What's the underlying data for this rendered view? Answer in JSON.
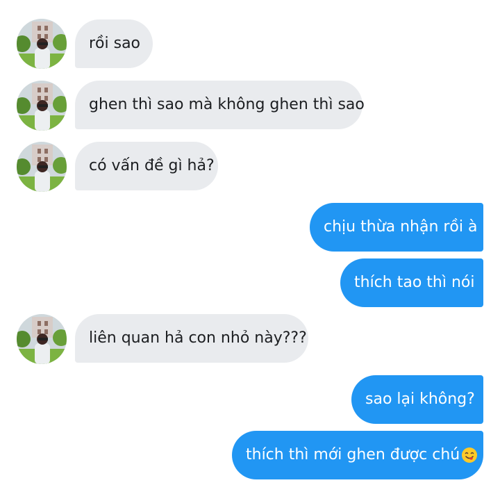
{
  "conversation": {
    "messages": [
      {
        "side": "in",
        "text": "rồi sao"
      },
      {
        "side": "in",
        "text": "ghen thì sao mà không ghen thì sao"
      },
      {
        "side": "in",
        "text": "có vấn đề gì hả?"
      },
      {
        "side": "out",
        "text": "chịu thừa nhận rồi à"
      },
      {
        "side": "out",
        "text": "thích tao thì nói"
      },
      {
        "side": "in",
        "text": "liên quan hả con nhỏ này???"
      },
      {
        "side": "out",
        "text": "sao lại không?"
      },
      {
        "side": "out",
        "text": "thích thì mới ghen được chú",
        "emoji": "smiling-face-savoring-food"
      }
    ]
  },
  "colors": {
    "incoming_bubble": "#e9ebee",
    "outgoing_bubble": "#2196f3",
    "outgoing_text": "#ffffff",
    "incoming_text": "#1c1e21"
  }
}
